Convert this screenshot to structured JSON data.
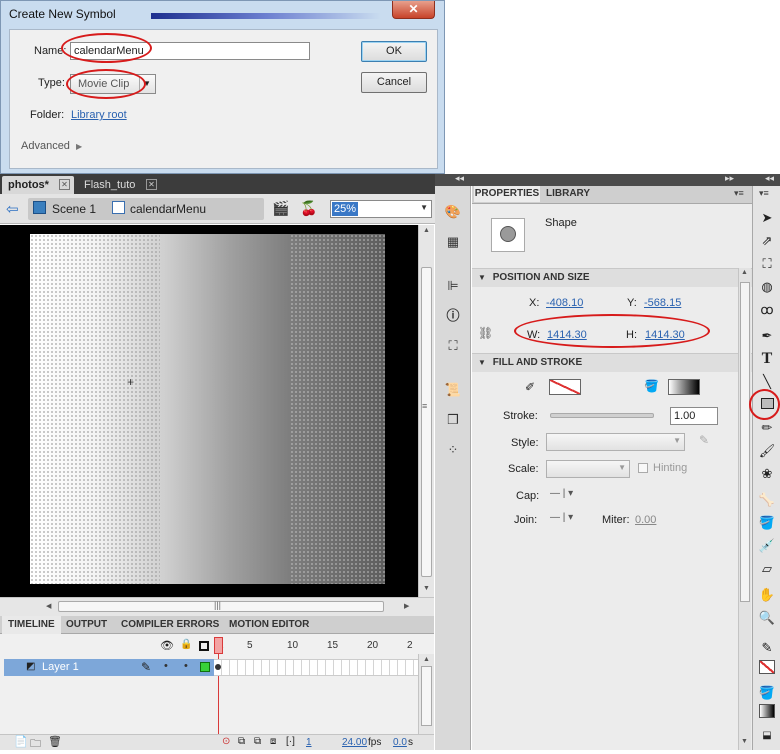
{
  "dialog": {
    "title": "Create New Symbol",
    "close_glyph": "✕",
    "name_label": "Name:",
    "name_value": "calendarMenu",
    "type_label": "Type:",
    "type_value": "Movie Clip",
    "folder_label": "Folder:",
    "folder_value": "Library root",
    "advanced_label": "Advanced",
    "ok_label": "OK",
    "cancel_label": "Cancel"
  },
  "doc_tabs": [
    {
      "label": "photos*"
    },
    {
      "label": "Flash_tuto"
    }
  ],
  "breadcrumb": {
    "scene": "Scene 1",
    "symbol": "calendarMenu",
    "zoom": "25%"
  },
  "timeline": {
    "tabs": [
      "TIMELINE",
      "OUTPUT",
      "COMPILER ERRORS",
      "MOTION EDITOR"
    ],
    "frame_numbers": [
      "1",
      "5",
      "10",
      "15",
      "20",
      "2"
    ],
    "layer_name": "Layer 1",
    "status_frame": "1",
    "status_fps": "24.00",
    "fps_unit": "fps",
    "status_time": "0.0",
    "time_unit": "s"
  },
  "properties": {
    "tabs": [
      "PROPERTIES",
      "LIBRARY"
    ],
    "object_type": "Shape",
    "position_section": "POSITION AND SIZE",
    "x_label": "X:",
    "x_value": "-408.10",
    "y_label": "Y:",
    "y_value": "-568.15",
    "w_label": "W:",
    "w_value": "1414.30",
    "h_label": "H:",
    "h_value": "1414.30",
    "fill_section": "FILL AND STROKE",
    "stroke_label": "Stroke:",
    "stroke_value": "1.00",
    "style_label": "Style:",
    "scale_label": "Scale:",
    "hinting_label": "Hinting",
    "cap_label": "Cap:",
    "join_label": "Join:",
    "miter_label": "Miter:",
    "miter_value": "0.00"
  },
  "colors": {
    "highlight_ring": "#d71b1b",
    "layer_selected": "#7da7d9",
    "playhead": "#d93a3a",
    "stage_bg": "#000000"
  }
}
